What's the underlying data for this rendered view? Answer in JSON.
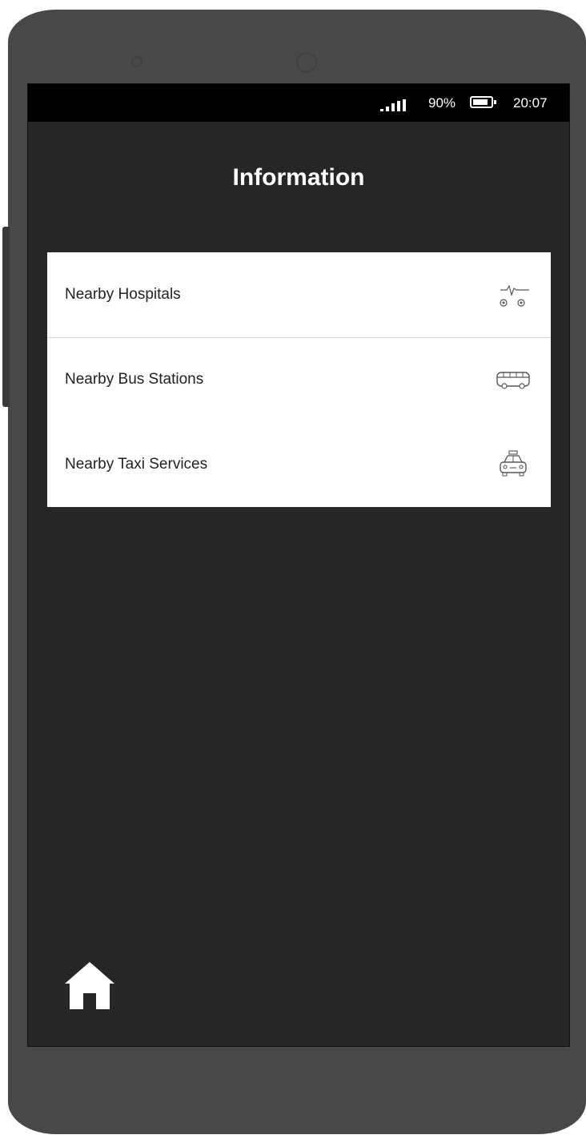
{
  "status_bar": {
    "battery_percent": "90%",
    "time": "20:07",
    "battery_level": 0.9
  },
  "header": {
    "title": "Information"
  },
  "list": {
    "items": [
      {
        "label": "Nearby Hospitals",
        "icon": "ambulance-icon"
      },
      {
        "label": "Nearby Bus Stations",
        "icon": "bus-icon"
      },
      {
        "label": "Nearby Taxi Services",
        "icon": "taxi-icon"
      }
    ]
  },
  "nav": {
    "home_icon": "home-icon"
  },
  "colors": {
    "phone_body": "#484848",
    "screen_bg": "#262626",
    "status_bar_bg": "#000000",
    "list_bg": "#ffffff",
    "text_dark": "#222222",
    "text_light": "#ffffff"
  }
}
